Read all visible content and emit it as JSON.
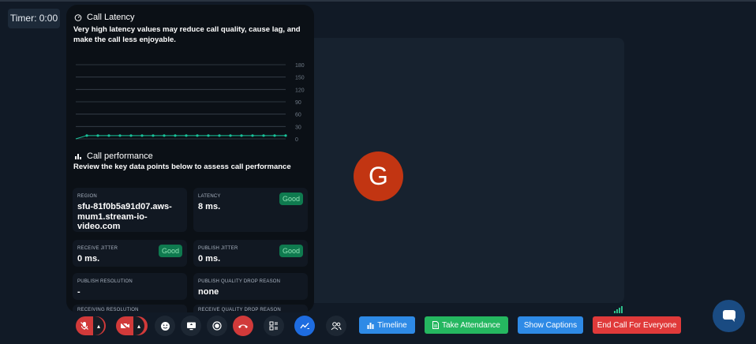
{
  "timer": {
    "label": "Timer: 0:00"
  },
  "participant": {
    "initial": "G"
  },
  "latency_panel": {
    "title": "Call Latency",
    "description": "Very high latency values may reduce call quality, cause lag, and make the call less enjoyable.",
    "chart_data": {
      "type": "line",
      "y_ticks": [
        "180",
        "150",
        "120",
        "90",
        "60",
        "30",
        "0"
      ],
      "ylim": [
        0,
        180
      ],
      "values": [
        8,
        8,
        8,
        8,
        8,
        8,
        8,
        8,
        8,
        8,
        8,
        8,
        8,
        8,
        8,
        8,
        8,
        8,
        8
      ],
      "grid": true,
      "line_color": "#19c39a"
    }
  },
  "performance": {
    "title": "Call performance",
    "description": "Review the key data points below to assess call performance",
    "cards": {
      "region": {
        "label": "REGION",
        "value": "sfu-81f0b5a91d07.aws-mum1.stream-io-video.com"
      },
      "latency": {
        "label": "LATENCY",
        "value": "8 ms.",
        "badge": "Good"
      },
      "receive_jitter": {
        "label": "RECEIVE JITTER",
        "value": "0 ms.",
        "badge": "Good"
      },
      "publish_jitter": {
        "label": "PUBLISH JITTER",
        "value": "0 ms.",
        "badge": "Good"
      },
      "publish_resolution": {
        "label": "PUBLISH RESOLUTION",
        "value": "-"
      },
      "publish_quality_drop": {
        "label": "PUBLISH QUALITY DROP REASON",
        "value": "none"
      },
      "receiving_resolution": {
        "label": "RECEIVING RESOLUTION"
      },
      "receive_quality_drop": {
        "label": "RECEIVE QUALITY DROP REASON"
      }
    }
  },
  "controls": {
    "timeline": "Timeline",
    "take_attendance": "Take Attendance",
    "show_captions": "Show Captions",
    "end_call": "End Call For Everyone"
  },
  "colors": {
    "accent_blue": "#2e8ae6",
    "attendance_green": "#25b760",
    "end_red": "#e03a3a",
    "good_badge": "#0f7a4f"
  }
}
